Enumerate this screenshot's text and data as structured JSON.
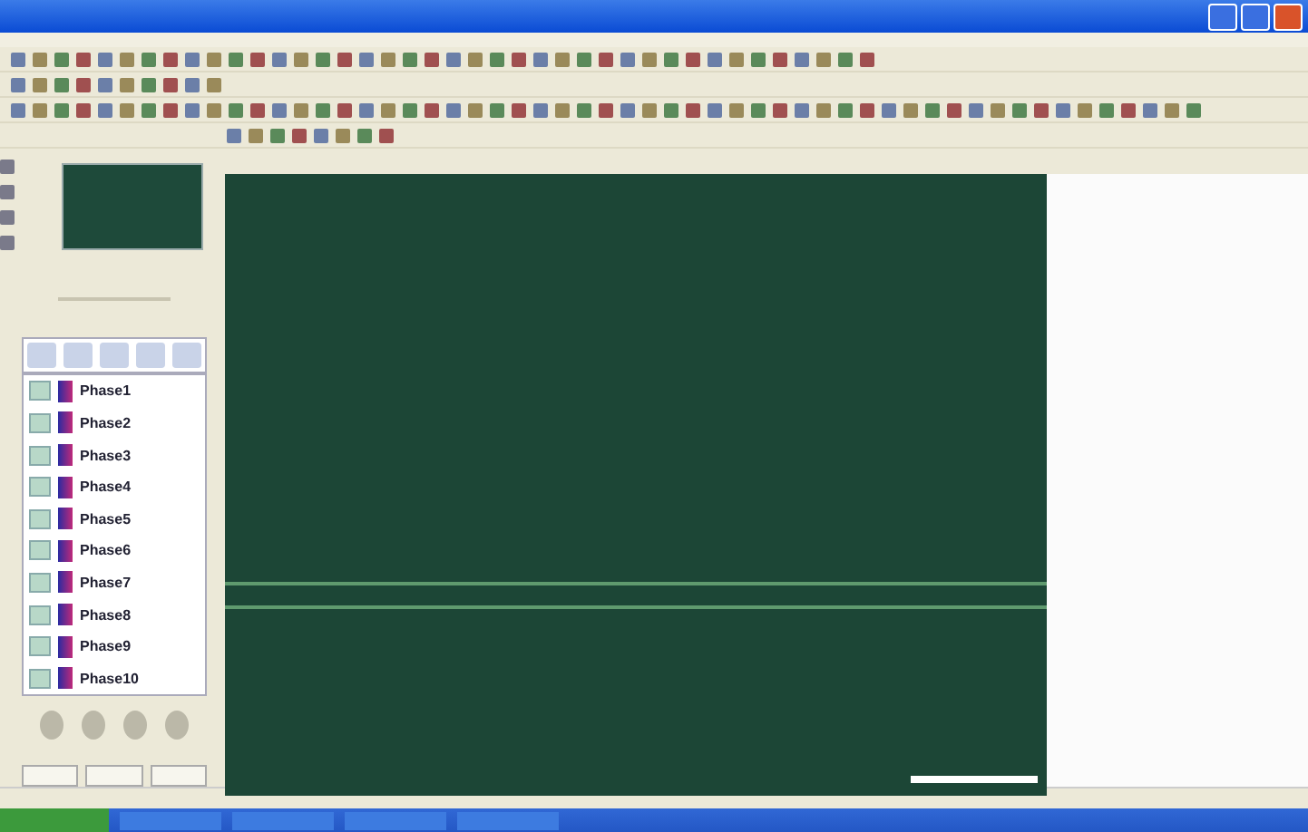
{
  "layers": [
    {
      "name": "Phase1"
    },
    {
      "name": "Phase2"
    },
    {
      "name": "Phase3"
    },
    {
      "name": "Phase4"
    },
    {
      "name": "Phase5"
    },
    {
      "name": "Phase6"
    },
    {
      "name": "Phase7"
    },
    {
      "name": "Phase8"
    },
    {
      "name": "Phase9"
    },
    {
      "name": "Phase10"
    }
  ]
}
